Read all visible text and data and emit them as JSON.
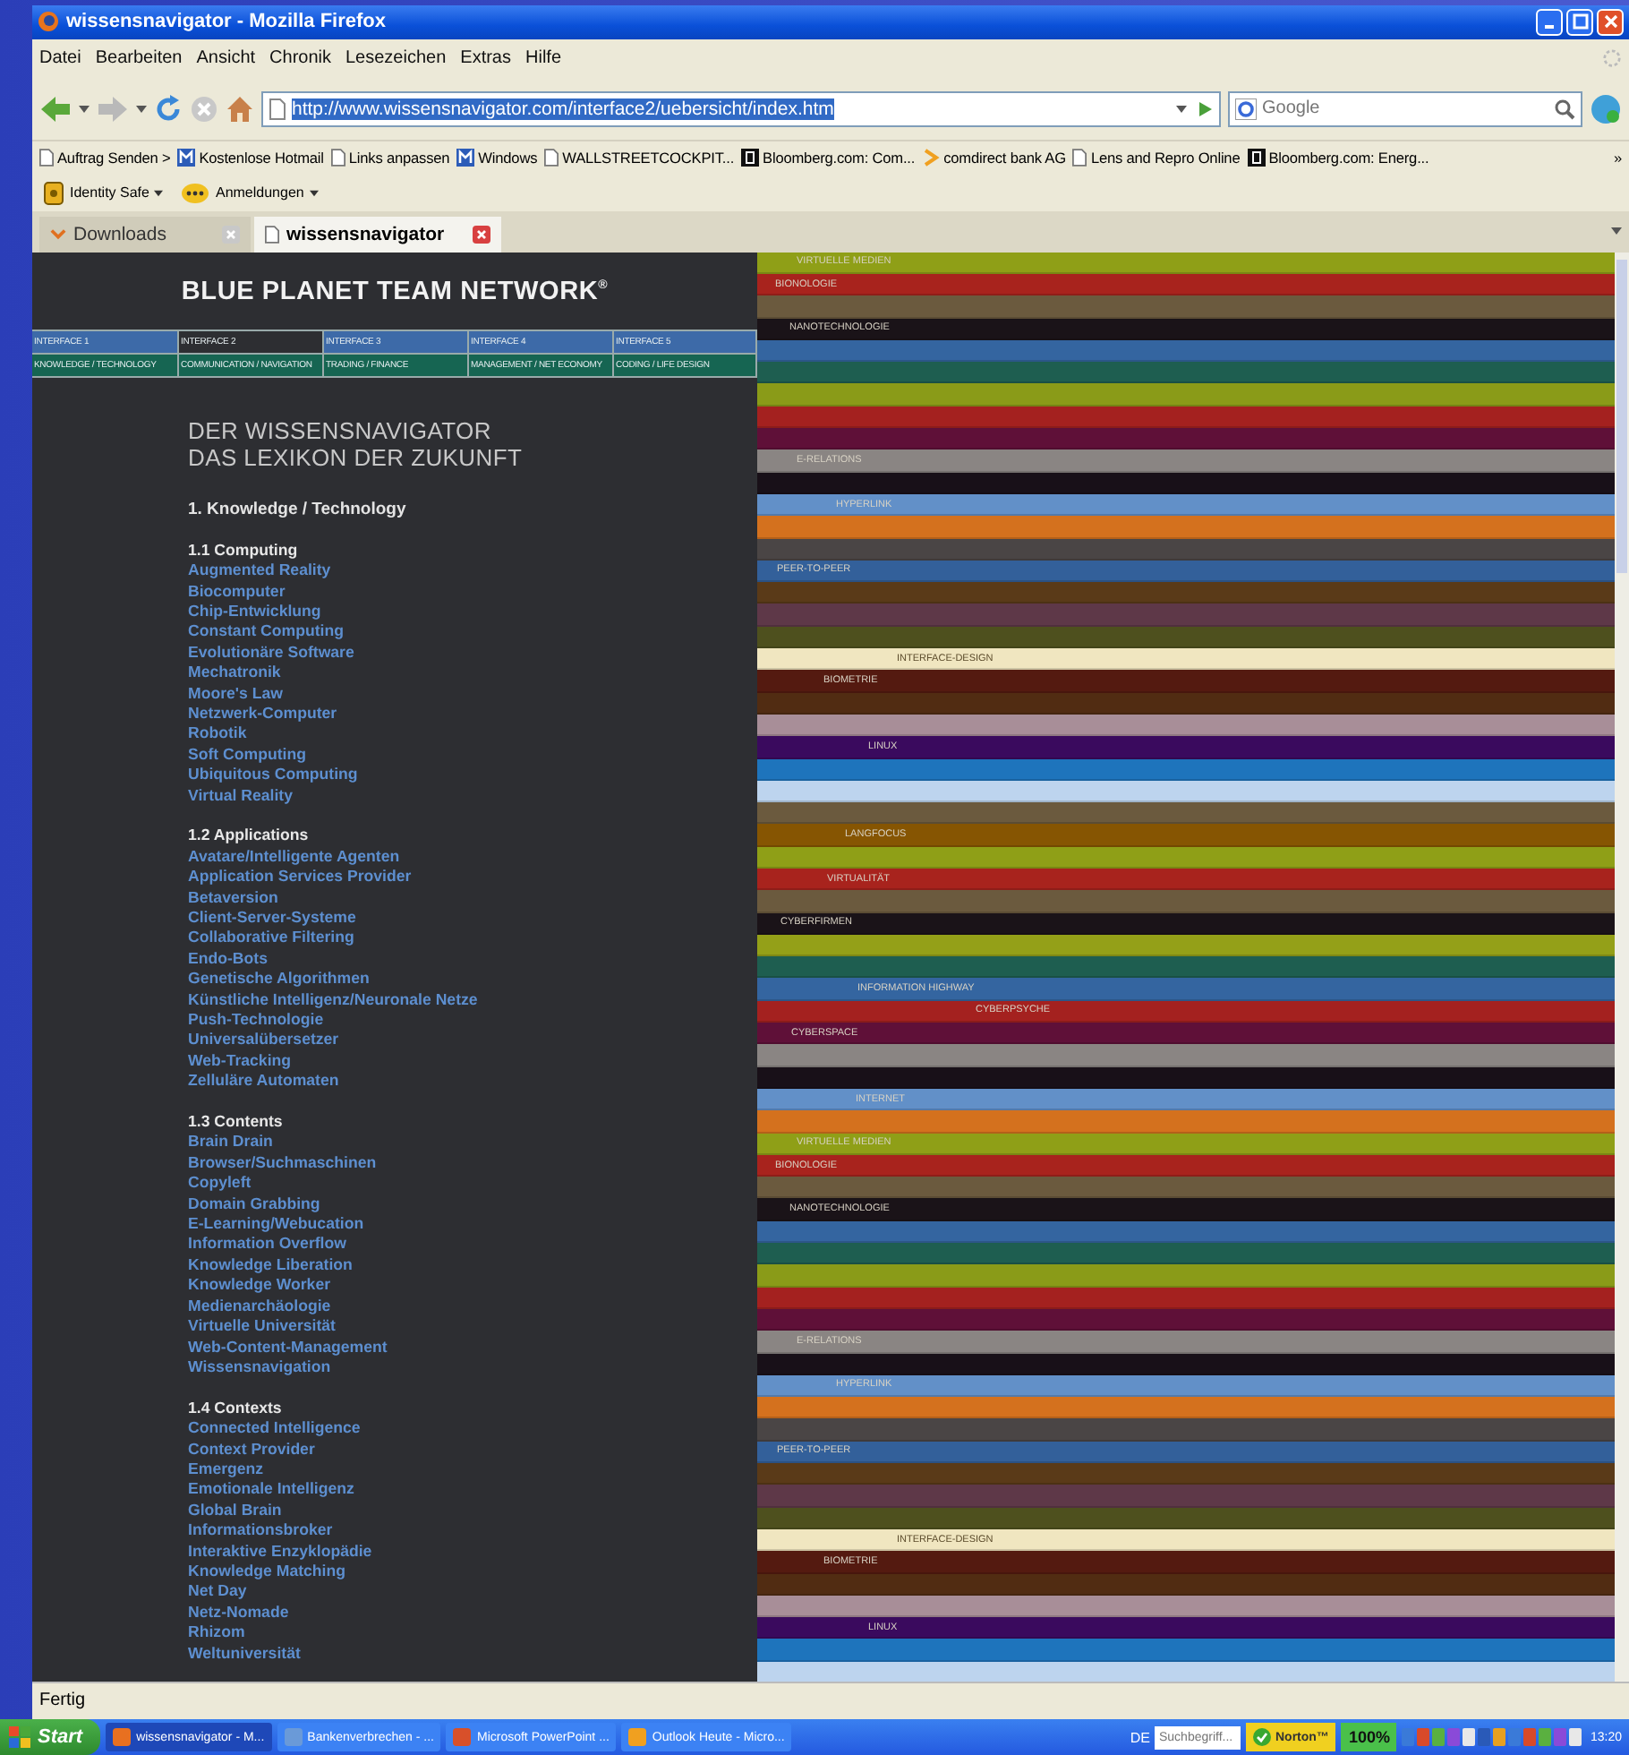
{
  "window": {
    "title": "wissensnavigator - Mozilla Firefox"
  },
  "menu": [
    "Datei",
    "Bearbeiten",
    "Ansicht",
    "Chronik",
    "Lesezeichen",
    "Extras",
    "Hilfe"
  ],
  "address_bar": {
    "url": "http://www.wissensnavigator.com/interface2/uebersicht/index.htm"
  },
  "search": {
    "placeholder": "Google"
  },
  "bookmarks": [
    {
      "label": "Auftrag Senden >",
      "kind": "page"
    },
    {
      "label": "Kostenlose Hotmail",
      "kind": "m"
    },
    {
      "label": "Links anpassen",
      "kind": "page"
    },
    {
      "label": "Windows",
      "kind": "m"
    },
    {
      "label": "WALLSTREETCOCKPIT...",
      "kind": "page"
    },
    {
      "label": "Bloomberg.com: Com...",
      "kind": "b"
    },
    {
      "label": "comdirect bank AG",
      "kind": "chevron"
    },
    {
      "label": "Lens and Repro Online",
      "kind": "page"
    },
    {
      "label": "Bloomberg.com: Energ...",
      "kind": "b"
    }
  ],
  "bookmarks_more": "»",
  "toolbar": [
    {
      "label": "Identity Safe",
      "kind": "safe"
    },
    {
      "label": "Anmeldungen",
      "kind": "dots"
    }
  ],
  "tabs": [
    {
      "label": "Downloads",
      "selected": false
    },
    {
      "label": "wissensnavigator",
      "selected": true
    }
  ],
  "page": {
    "brand": "BLUE PLANET TEAM NETWORK$^{®}$",
    "interfaces": [
      {
        "label": "INTERFACE 1",
        "topic": "KNOWLEDGE / TECHNOLOGY",
        "selected": false
      },
      {
        "label": "INTERFACE 2",
        "topic": "COMMUNICATION / NAVIGATION",
        "selected": true
      },
      {
        "label": "INTERFACE 3",
        "topic": "TRADING / FINANCE",
        "selected": false
      },
      {
        "label": "INTERFACE 4",
        "topic": "MANAGEMENT / NET ECONOMY",
        "selected": false
      },
      {
        "label": "INTERFACE 5",
        "topic": "CODING / LIFE DESIGN",
        "selected": false
      }
    ],
    "heading": [
      "DER WISSENSNAVIGATOR",
      "DAS LEXIKON DER ZUKUNFT"
    ],
    "chapter": "1. Knowledge / Technology",
    "sections": [
      {
        "title": "1.1 Computing",
        "items": [
          "Augmented Reality",
          "Biocomputer",
          "Chip-Entwicklung",
          "Constant Computing",
          "Evolutionäre Software",
          "Mechatronik",
          "Moore's Law",
          "Netzwerk-Computer",
          "Robotik",
          "Soft Computing",
          "Ubiquitous Computing",
          "Virtual Reality"
        ]
      },
      {
        "title": "1.2 Applications",
        "items": [
          "Avatare/Intelligente Agenten",
          "Application Services Provider",
          "Betaversion",
          "Client-Server-Systeme",
          "Collaborative Filtering",
          "Endo-Bots",
          "Genetische Algorithmen",
          "Künstliche Intelligenz/Neuronale Netze",
          "Push-Technologie",
          "Universalübersetzer",
          "Web-Tracking",
          "Zelluläre Automaten"
        ]
      },
      {
        "title": "1.3 Contents",
        "items": [
          "Brain Drain",
          "Browser/Suchmaschinen",
          "Copyleft",
          "Domain Grabbing",
          "E-Learning/Webucation",
          "Information Overflow",
          "Knowledge Liberation",
          "Knowledge Worker",
          "Medienarchäologie",
          "Virtuelle Universität",
          "Web-Content-Management",
          "Wissensnavigation"
        ]
      },
      {
        "title": "1.4 Contexts",
        "items": [
          "Connected Intelligence",
          "Context Provider",
          "Emergenz",
          "Emotionale Intelligenz",
          "Global Brain",
          "Informationsbroker",
          "Interaktive Enzyklopädie",
          "Knowledge Matching",
          "Net Day",
          "Netz-Nomade",
          "Rhizom",
          "Weltuniversität"
        ]
      }
    ]
  },
  "stripes": [
    {
      "color": "#8f9f17",
      "label": "VIRTUELLE MEDIEN"
    },
    {
      "color": "#a8231d",
      "label": "BIONOLOGIE"
    },
    {
      "color": "#6b5a3e"
    },
    {
      "color": "#1a1318",
      "label": "NANOTECHNOLOGIE"
    },
    {
      "color": "#3465a0"
    },
    {
      "color": "#1e5e50"
    },
    {
      "color": "#8a9b18"
    },
    {
      "color": "#a4211f"
    },
    {
      "color": "#5f1038"
    },
    {
      "color": "#8a8583",
      "label": "E-RELATIONS"
    },
    {
      "color": "#181018"
    },
    {
      "color": "#6290c8",
      "label": "HYPERLINK"
    },
    {
      "color": "#d4711e"
    },
    {
      "color": "#4a4545"
    },
    {
      "color": "#33609a",
      "label": "PEER-TO-PEER"
    },
    {
      "color": "#5a3a18"
    },
    {
      "color": "#5e3848"
    },
    {
      "color": "#4e501e"
    },
    {
      "color": "#f0e6c0",
      "label": "INTERFACE-DESIGN"
    },
    {
      "color": "#541a10",
      "label": "BIOMETRIE"
    },
    {
      "color": "#512c12"
    },
    {
      "color": "#a88e98"
    },
    {
      "color": "#3a0a5e",
      "label": "LINUX"
    },
    {
      "color": "#1e74bc"
    },
    {
      "color": "#bdd4ee"
    },
    {
      "color": "#6b5a3e"
    },
    {
      "color": "#865502",
      "label": "LANGFOCUS"
    },
    {
      "color": "#8f9f17"
    },
    {
      "color": "#a8231d",
      "label": "VIRTUALITÄT"
    },
    {
      "color": "#6b5a3e"
    },
    {
      "color": "#1a1318",
      "label": "CYBERFIRMEN"
    },
    {
      "color": "#94a018"
    },
    {
      "color": "#1e5e50"
    },
    {
      "color": "#3465a0",
      "label": "INFORMATION HIGHWAY"
    },
    {
      "color": "#a4211f",
      "label": "CYBERPSYCHE"
    },
    {
      "color": "#5f1038",
      "label": "CYBERSPACE"
    },
    {
      "color": "#8a8583"
    },
    {
      "color": "#181018"
    },
    {
      "color": "#6290c8",
      "label": "INTERNET"
    },
    {
      "color": "#d4711e"
    },
    {
      "color": "#8f9f17",
      "label": "VIRTUELLE MEDIEN"
    },
    {
      "color": "#a8231d",
      "label": "BIONOLOGIE"
    },
    {
      "color": "#6b5a3e"
    },
    {
      "color": "#1a1318",
      "label": "NANOTECHNOLOGIE"
    },
    {
      "color": "#3465a0"
    },
    {
      "color": "#1e5e50"
    },
    {
      "color": "#8a9b18"
    },
    {
      "color": "#a4211f"
    },
    {
      "color": "#5f1038"
    },
    {
      "color": "#8a8583",
      "label": "E-RELATIONS"
    },
    {
      "color": "#181018"
    },
    {
      "color": "#6290c8",
      "label": "HYPERLINK"
    },
    {
      "color": "#d4711e"
    },
    {
      "color": "#4a4545"
    },
    {
      "color": "#33609a",
      "label": "PEER-TO-PEER"
    },
    {
      "color": "#5a3a18"
    },
    {
      "color": "#5e3848"
    },
    {
      "color": "#4e501e"
    },
    {
      "color": "#f0e6c0",
      "label": "INTERFACE-DESIGN"
    },
    {
      "color": "#541a10",
      "label": "BIOMETRIE"
    },
    {
      "color": "#512c12"
    },
    {
      "color": "#a88e98"
    },
    {
      "color": "#3a0a5e",
      "label": "LINUX"
    },
    {
      "color": "#1e74bc"
    },
    {
      "color": "#bdd4ee"
    }
  ],
  "status_bar": "Fertig",
  "taskbar": {
    "start": "Start",
    "tasks": [
      {
        "label": "wissensnavigator - M...",
        "selected": true
      },
      {
        "label": "Bankenverbrechen - ...",
        "selected": false
      },
      {
        "label": "Microsoft PowerPoint ...",
        "selected": false
      },
      {
        "label": "Outlook Heute - Micro...",
        "selected": false
      }
    ],
    "language": "DE",
    "search_placeholder": "Suchbegriff...",
    "norton": "Norton™",
    "zoom": "100%",
    "clock": "13:20"
  }
}
